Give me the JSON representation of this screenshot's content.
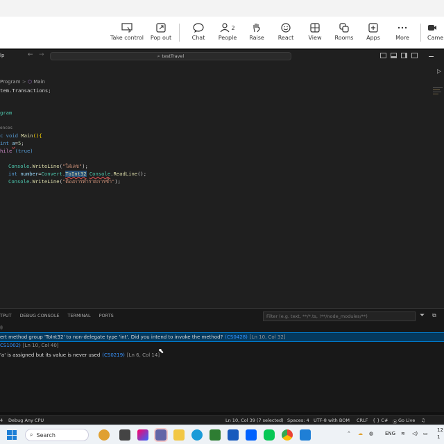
{
  "teams": {
    "buttons": [
      {
        "label": "Take control",
        "icon": "take-control-icon"
      },
      {
        "label": "Pop out",
        "icon": "pop-out-icon"
      },
      {
        "label": "Chat",
        "icon": "chat-icon"
      },
      {
        "label": "People",
        "icon": "people-icon",
        "count": "2"
      },
      {
        "label": "Raise",
        "icon": "raise-hand-icon"
      },
      {
        "label": "React",
        "icon": "react-icon"
      },
      {
        "label": "View",
        "icon": "view-icon"
      },
      {
        "label": "Rooms",
        "icon": "rooms-icon"
      },
      {
        "label": "Apps",
        "icon": "apps-icon"
      },
      {
        "label": "More",
        "icon": "more-icon"
      },
      {
        "label": "Came",
        "icon": "camera-icon"
      }
    ]
  },
  "vscode": {
    "menu_partial": "lp",
    "search": "testTravel",
    "breadcrumb": {
      "a": "Program",
      "sep": ">",
      "b": "Main"
    },
    "code": {
      "l1": "tem.Transactions;",
      "l2": "gram",
      "l3": "ences",
      "l4a": "c void ",
      "l4b": "Main",
      "l4c": "(){",
      "l5a": "int ",
      "l5b": "a",
      "l5c": "=",
      "l5d": "5",
      "l5e": ";",
      "l6a": "hile ",
      "l6b": "(true)",
      "l7a": "Console",
      "l7b": ".",
      "l7c": "WriteLine",
      "l7d": "(",
      "l7e": "\"ใส่เลข\"",
      "l7f": ");",
      "l8a": "int ",
      "l8b": "number",
      "l8c": "=",
      "l8d": "Convert",
      "l8e": ".",
      "l8f": "ToInt32",
      "l8g": " ",
      "l8h": "Console",
      "l8i": ".",
      "l8j": "ReadLine",
      "l8k": "();",
      "l9a": "Console",
      "l9b": ".",
      "l9c": "WriteLine",
      "l9d": "(",
      "l9e": "\"ต้องการทำรายการซ้ำ\"",
      "l9f": ");"
    },
    "panel": {
      "tabs": [
        "TPUT",
        "DEBUG CONSOLE",
        "TERMINAL",
        "PORTS"
      ],
      "filter_placeholder": "Filter (e.g. text, **/*.ts, !**/node_modules/**)",
      "problems": [
        {
          "text": "ert method group 'ToInt32' to non-delegate type 'int'. Did you intend to invoke the method?",
          "code": "(CS0428)",
          "loc": "[Ln 10, Col 32]"
        },
        {
          "text": "",
          "code": "CS1002)",
          "loc": "[Ln 10, Col 40]"
        },
        {
          "text": "'a' is assigned but its value is never used",
          "code": "(CS0219)",
          "loc": "[Ln 6, Col 14]"
        }
      ]
    },
    "status": {
      "left": "4",
      "debug": "Debug Any CPU",
      "pos": "Ln 10, Col 39 (7 selected)",
      "spaces": "Spaces: 4",
      "encoding": "UTF-8 with BOM",
      "eol": "CRLF",
      "lang": "{ } C#",
      "live": "Go Live"
    }
  },
  "taskbar": {
    "search": "Search",
    "lang": "ENG",
    "time": "12",
    "date": "1"
  }
}
